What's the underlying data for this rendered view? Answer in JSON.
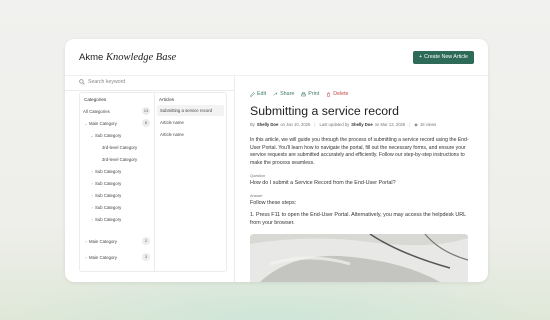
{
  "app": {
    "brand_plain": "Akme",
    "brand_italic": "Knowledge Base",
    "create_button": "Create New Article"
  },
  "search": {
    "placeholder": "Search keyword"
  },
  "sidebar": {
    "categories_header": "Categories",
    "articles_header": "Articles",
    "categories": [
      {
        "label": "All Categories",
        "count": "13"
      },
      {
        "label": "Main Category",
        "count": "8"
      },
      {
        "label": "Sub Category"
      },
      {
        "label": "3rd-level Category"
      },
      {
        "label": "3rd-level Category"
      },
      {
        "label": "Sub Category"
      },
      {
        "label": "Sub Category"
      },
      {
        "label": "Sub Category"
      },
      {
        "label": "Sub Category"
      },
      {
        "label": "Sub Category"
      },
      {
        "label": "Main Category",
        "count": "2"
      },
      {
        "label": "Main Category",
        "count": "3"
      }
    ],
    "articles": [
      {
        "label": "Submitting a service record"
      },
      {
        "label": "Article name"
      },
      {
        "label": "Article name"
      }
    ]
  },
  "toolbar": {
    "edit": "Edit",
    "share": "Share",
    "print": "Print",
    "delete": "Delete"
  },
  "article": {
    "title": "Submitting a service record",
    "by": "By",
    "author": "Shelly Doe",
    "on": "on Jan 10, 2025",
    "updated_by_label": "Last updated by",
    "updater": "Shelly Doe",
    "updated_on": "on Mar 13, 2025",
    "views": "18 views",
    "intro": "In this article, we will guide you through the process of submitting a service record using the End-User Portal. You'll learn how to navigate the portal, fill out the necessary forms, and ensure your service requests are submitted accurately and efficiently. Follow our step-by-step instructions to make the process seamless.",
    "question_label": "Question",
    "question": "How do I submit a Service Record from the End-User Portal?",
    "answer_label": "Answer",
    "answer_intro": "Follow these steps:",
    "step1": "1. Press F11 to open the End-User Portal. Alternatively, you may access the helpdesk URL from your browser."
  },
  "colors": {
    "accent": "#2d6b58",
    "link": "#3a7a62",
    "danger": "#c24848"
  }
}
